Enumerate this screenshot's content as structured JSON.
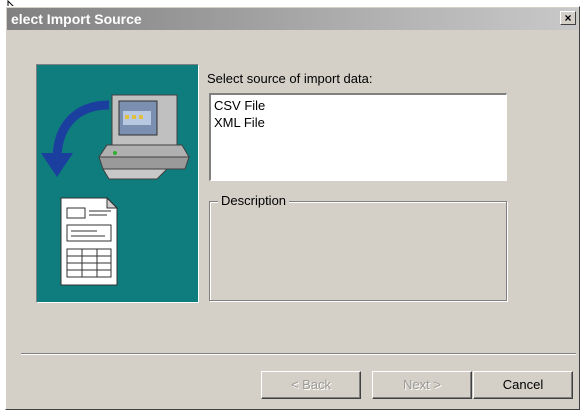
{
  "window": {
    "title": "elect Import Source",
    "close_label": "×"
  },
  "source": {
    "label": "Select source of import data:",
    "items": [
      "CSV File",
      "XML File"
    ]
  },
  "description": {
    "legend": "Description",
    "text": ""
  },
  "buttons": {
    "back": "< Back",
    "next": "Next >",
    "cancel": "Cancel"
  },
  "colors": {
    "illustration_bg": "#0f7d7d",
    "dialog_face": "#d4d0c8"
  }
}
